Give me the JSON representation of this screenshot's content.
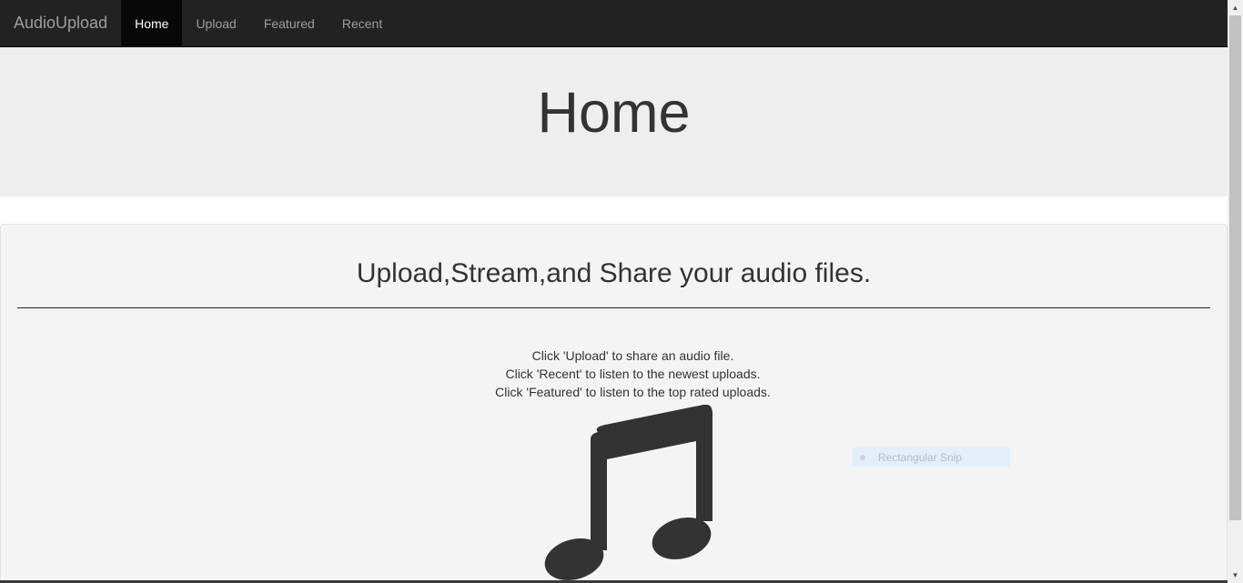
{
  "navbar": {
    "brand": "AudioUpload",
    "items": [
      {
        "label": "Home",
        "active": true
      },
      {
        "label": "Upload",
        "active": false
      },
      {
        "label": "Featured",
        "active": false
      },
      {
        "label": "Recent",
        "active": false
      }
    ]
  },
  "jumbotron": {
    "title": "Home"
  },
  "main": {
    "heading": "Upload,Stream,and Share your audio files.",
    "instructions": [
      "Click 'Upload' to share an audio file.",
      "Click 'Recent' to listen to the newest uploads.",
      "Click 'Featured' to listen to the top rated uploads."
    ],
    "icon": "music-note-icon"
  },
  "overlay": {
    "snip_label": "Rectangular Snip"
  },
  "colors": {
    "navbar_bg": "#222222",
    "active_bg": "#080808",
    "jumbotron_bg": "#eeeeee",
    "well_bg": "#f4f4f4",
    "icon_color": "#333333"
  }
}
